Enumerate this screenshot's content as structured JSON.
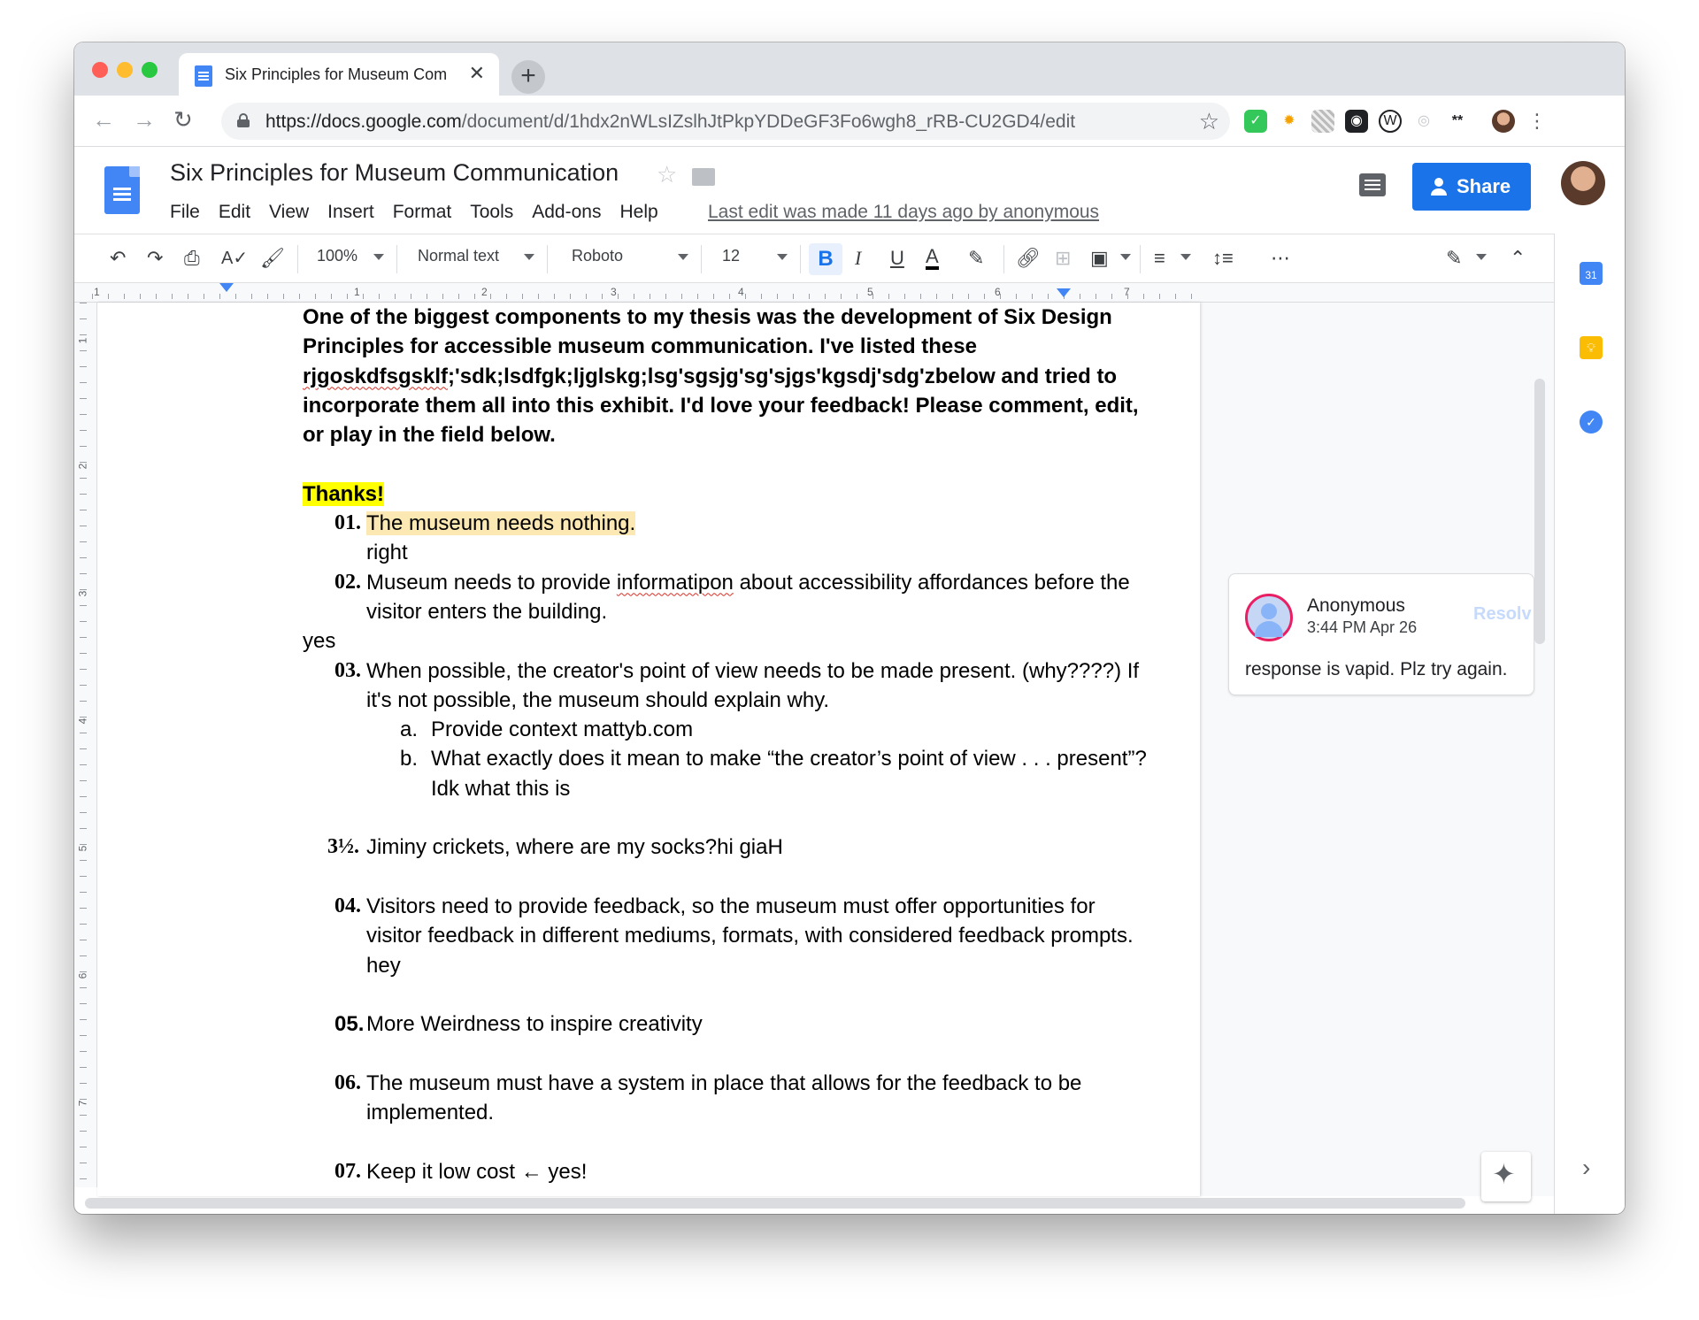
{
  "browser": {
    "tab_title": "Six Principles for Museum Com",
    "tab_close": "✕",
    "new_tab": "+",
    "url_host": "https://docs.google.com",
    "url_path": "/document/d/1hdx2nWLsIZslhJtPkpYDDeGF3Fo6wgh8_rRB-CU2GD4/edit"
  },
  "docs": {
    "title": "Six Principles for Museum Communication",
    "menu": [
      "File",
      "Edit",
      "View",
      "Insert",
      "Format",
      "Tools",
      "Add-ons",
      "Help"
    ],
    "last_edit": "Last edit was made 11 days ago by anonymous",
    "share_label": "Share"
  },
  "format_toolbar": {
    "zoom": "100%",
    "style": "Normal text",
    "font": "Roboto",
    "size": "12"
  },
  "ruler": {
    "numbers": [
      "1",
      "1",
      "2",
      "3",
      "4",
      "5",
      "6",
      "7"
    ],
    "vertical_numbers": [
      "1",
      "2",
      "3",
      "4",
      "5",
      "6",
      "7"
    ]
  },
  "document": {
    "intro_1": "One of the biggest components to my thesis was the development of Six Design Principles for accessible museum communication. I've listed these ",
    "intro_typo": "rjgoskdfsgsklf",
    "intro_2": ";'sdk;lsdfgk;ljglskg;lsg'sgsjg'sg'sjgs'kgsdj'sdg'zbelow and tried to incorporate them all into this exhibit. I'd love your feedback! Please comment, edit, or play in the field below.",
    "thanks": "Thanks!",
    "items": [
      {
        "num": "01.",
        "text": "The museum needs nothing.",
        "sub": "right"
      },
      {
        "num": "02.",
        "text_1": "Museum needs to provide ",
        "typo": "informatipon",
        "text_2": " about accessibility affordances before the visitor enters the building."
      },
      {
        "num": "03.",
        "text": "When possible, the creator's point of view needs to be made present. (why????) If it's not possible, the museum should explain why."
      },
      {
        "num": "3½.",
        "text": "Jiminy crickets, where are my socks?hi giaH"
      },
      {
        "num": "04.",
        "text": "Visitors need to provide feedback, so the museum must offer opportunities for visitor feedback in different mediums, formats, with considered feedback prompts. hey"
      },
      {
        "num": "05.",
        "text": "More Weirdness to inspire creativity"
      },
      {
        "num": "06.",
        "text": "The museum must have a system in place that allows for the feedback to be implemented."
      },
      {
        "num": "07.",
        "text": "Keep it low cost ← yes!"
      }
    ],
    "yes_line": "yes",
    "sub_items": [
      {
        "num": "a.",
        "text": "Provide context mattyb.com"
      },
      {
        "num": "b.",
        "text": "What exactly does it mean to make “the creator’s point of view . . . present”? Idk what this is"
      }
    ]
  },
  "comment": {
    "author": "Anonymous",
    "time": "3:44 PM Apr 26",
    "resolve": "Resolv",
    "text": "response is vapid. Plz try again."
  },
  "colors": {
    "accent": "#1a73e8",
    "highlight_yellow": "#ffff00",
    "comment_highlight": "#fce8b2",
    "spell_error": "#d93025"
  }
}
